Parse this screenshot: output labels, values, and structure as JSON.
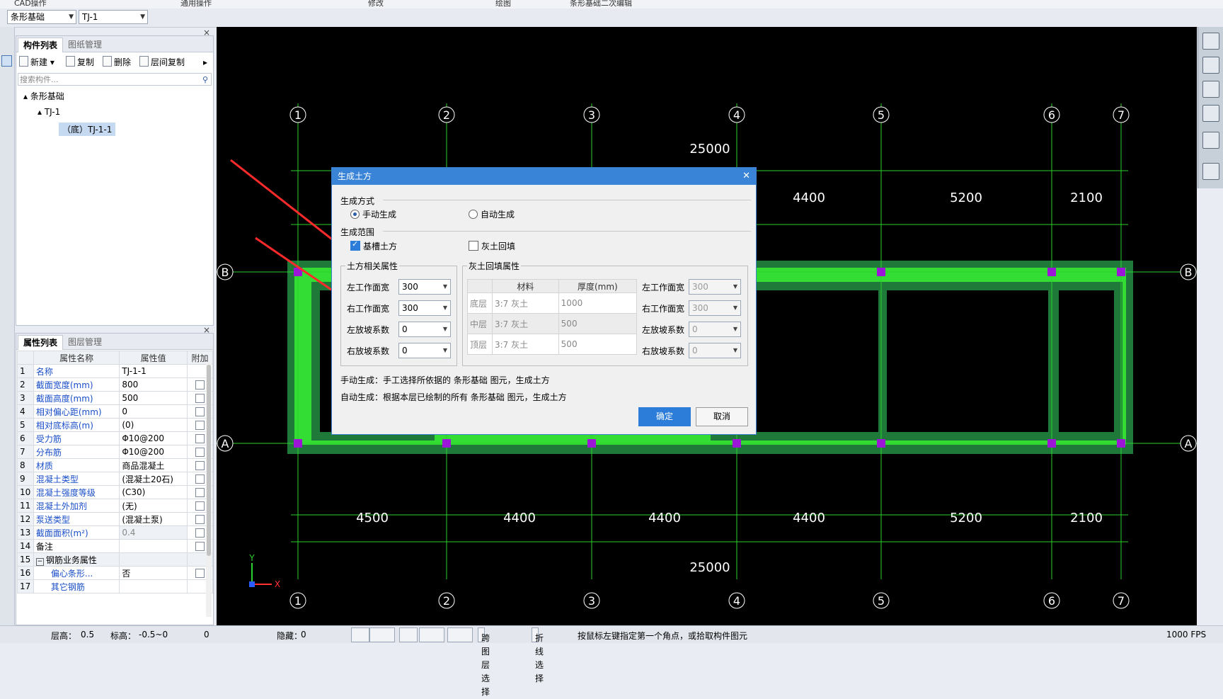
{
  "ribbon": {
    "items": [
      "CAD操作",
      "通用操作",
      "修改",
      "绘图",
      "条形基础二次编辑"
    ]
  },
  "combos": {
    "layer": "条形基础",
    "component": "TJ-1"
  },
  "component_panel": {
    "tabs": [
      "构件列表",
      "图纸管理"
    ],
    "toolbar": [
      "新建",
      "复制",
      "删除",
      "层间复制"
    ],
    "search_placeholder": "搜索构件...",
    "tree": {
      "root": "条形基础",
      "child": "TJ-1",
      "leaf": "（底）TJ-1-1"
    }
  },
  "property_panel": {
    "tabs": [
      "属性列表",
      "图层管理"
    ],
    "headers": [
      "属性名称",
      "属性值",
      "附加"
    ],
    "rows": [
      {
        "n": "1",
        "name": "名称",
        "value": "TJ-1-1"
      },
      {
        "n": "2",
        "name": "截面宽度(mm)",
        "value": "800"
      },
      {
        "n": "3",
        "name": "截面高度(mm)",
        "value": "500"
      },
      {
        "n": "4",
        "name": "相对偏心距(mm)",
        "value": "0"
      },
      {
        "n": "5",
        "name": "相对底标高(m)",
        "value": "(0)"
      },
      {
        "n": "6",
        "name": "受力筋",
        "value": "Φ10@200"
      },
      {
        "n": "7",
        "name": "分布筋",
        "value": "Φ10@200"
      },
      {
        "n": "8",
        "name": "材质",
        "value": "商品混凝土"
      },
      {
        "n": "9",
        "name": "混凝土类型",
        "value": "(混凝土20石)"
      },
      {
        "n": "10",
        "name": "混凝土强度等级",
        "value": "(C30)"
      },
      {
        "n": "11",
        "name": "混凝土外加剂",
        "value": "(无)"
      },
      {
        "n": "12",
        "name": "泵送类型",
        "value": "(混凝土泵)"
      },
      {
        "n": "13",
        "name": "截面面积(m²)",
        "value": "0.4"
      },
      {
        "n": "14",
        "name": "备注",
        "value": ""
      },
      {
        "n": "15",
        "name": "钢筋业务属性",
        "value": ""
      },
      {
        "n": "16",
        "name": "偏心条形...",
        "value": "否"
      },
      {
        "n": "17",
        "name": "其它钢筋",
        "value": ""
      }
    ]
  },
  "drawing": {
    "axes_top": [
      "1",
      "2",
      "3",
      "4",
      "5",
      "6",
      "7"
    ],
    "axes_side": [
      "B",
      "A"
    ],
    "total_dim": "25000",
    "spans": [
      "4500",
      "4400",
      "4400",
      "4400",
      "5200",
      "2100"
    ],
    "colors": {
      "background": "#000000",
      "grid": "#2bd12b",
      "footing": "#33dd33",
      "footing_dark": "#1f7a3a",
      "node": "#9b16d6",
      "arrow": "#ff2a2a"
    }
  },
  "dialog": {
    "title": "生成土方",
    "close_icon": "close-icon",
    "method_label": "生成方式",
    "method_manual": "手动生成",
    "method_auto": "自动生成",
    "scope_label": "生成范围",
    "scope_trench": "基槽土方",
    "scope_backfill": "灰土回填",
    "earth_group": "土方相关属性",
    "earth_fields": [
      {
        "label": "左工作面宽",
        "value": "300"
      },
      {
        "label": "右工作面宽",
        "value": "300"
      },
      {
        "label": "左放坡系数",
        "value": "0"
      },
      {
        "label": "右放坡系数",
        "value": "0"
      }
    ],
    "backfill_group": "灰土回填属性",
    "backfill_headers": [
      "材料",
      "厚度(mm)"
    ],
    "backfill_rows": [
      {
        "layer": "底层",
        "material": "3:7 灰土",
        "thickness": "1000"
      },
      {
        "layer": "中层",
        "material": "3:7 灰土",
        "thickness": "500"
      },
      {
        "layer": "顶层",
        "material": "3:7 灰土",
        "thickness": "500"
      }
    ],
    "backfill_fields": [
      {
        "label": "左工作面宽",
        "value": "300"
      },
      {
        "label": "右工作面宽",
        "value": "300"
      },
      {
        "label": "左放坡系数",
        "value": "0"
      },
      {
        "label": "右放坡系数",
        "value": "0"
      }
    ],
    "note_manual": "手动生成：手工选择所依据的 条形基础 图元，生成土方",
    "note_auto": "自动生成：根据本层已绘制的所有 条形基础 图元，生成土方",
    "ok": "确定",
    "cancel": "取消"
  },
  "status": {
    "floor_height": "层高：",
    "floor_height_val": "0.5",
    "elevation": "标高：",
    "elevation_val": "-0.5~0",
    "count": "0",
    "hidden": "隐藏：",
    "hidden_val": "0",
    "btn_cross_layer": "跨图层选择",
    "btn_polyline": "折线选择",
    "hint": "按鼠标左键指定第一个角点，或拾取构件图元",
    "fps": "1000 FPS"
  }
}
